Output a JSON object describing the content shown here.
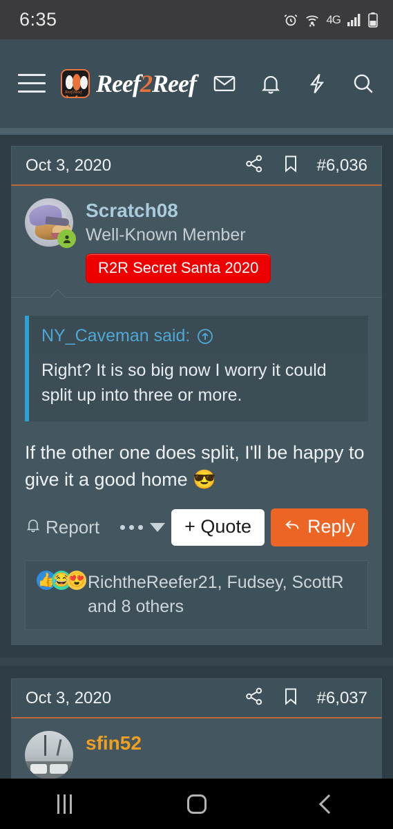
{
  "status_bar": {
    "time": "6:35",
    "icons": [
      "alarm-icon",
      "wifi-icon",
      "4g-icon",
      "signal-icon",
      "battery-icon"
    ],
    "network_label": "4G"
  },
  "header": {
    "menu_icon": "hamburger-menu-icon",
    "logo_alt": "Reef2Reef",
    "brand_part1": "Reef",
    "brand_two": "2",
    "brand_part2": "Reef",
    "icons": [
      "mail-icon",
      "bell-icon",
      "lightning-bolt-icon",
      "search-icon"
    ],
    "accent_color": "#e9733b"
  },
  "posts": [
    {
      "date": "Oct 3, 2020",
      "post_number": "#6,036",
      "share_icon": "share-nodes-icon",
      "bookmark_icon": "bookmark-icon",
      "username": "Scratch08",
      "user_title": "Well-Known Member",
      "user_badge": "R2R Secret Santa 2020",
      "badge_color": "#ef0000",
      "online_status": "online",
      "quote": {
        "author_line": "NY_Caveman said:",
        "jump_icon": "arrow-up-circle-icon",
        "text": "Right? It is so big now I worry it could split up into three or more."
      },
      "body_text": "If the other one does split, I'll be happy to give it a good home ",
      "body_emoji": "😎",
      "actions": {
        "report_label": "Report",
        "report_icon": "bell-icon",
        "more_icon": "more-options-icon",
        "quote_label": "+ Quote",
        "reply_label": "Reply",
        "reply_icon": "reply-arrow-icon"
      },
      "reactions": {
        "emojis": [
          "👍",
          "😂",
          "😍"
        ],
        "names": "RichtheReefer21, Fudsey, ScottR and 8 others"
      }
    },
    {
      "date": "Oct 3, 2020",
      "post_number": "#6,037",
      "share_icon": "share-nodes-icon",
      "bookmark_icon": "bookmark-icon",
      "username": "sfin52",
      "username_color": "#f0a020"
    }
  ],
  "nav_bar": {
    "recents_label": "recents-icon",
    "home_label": "home-icon",
    "back_label": "back-icon"
  }
}
